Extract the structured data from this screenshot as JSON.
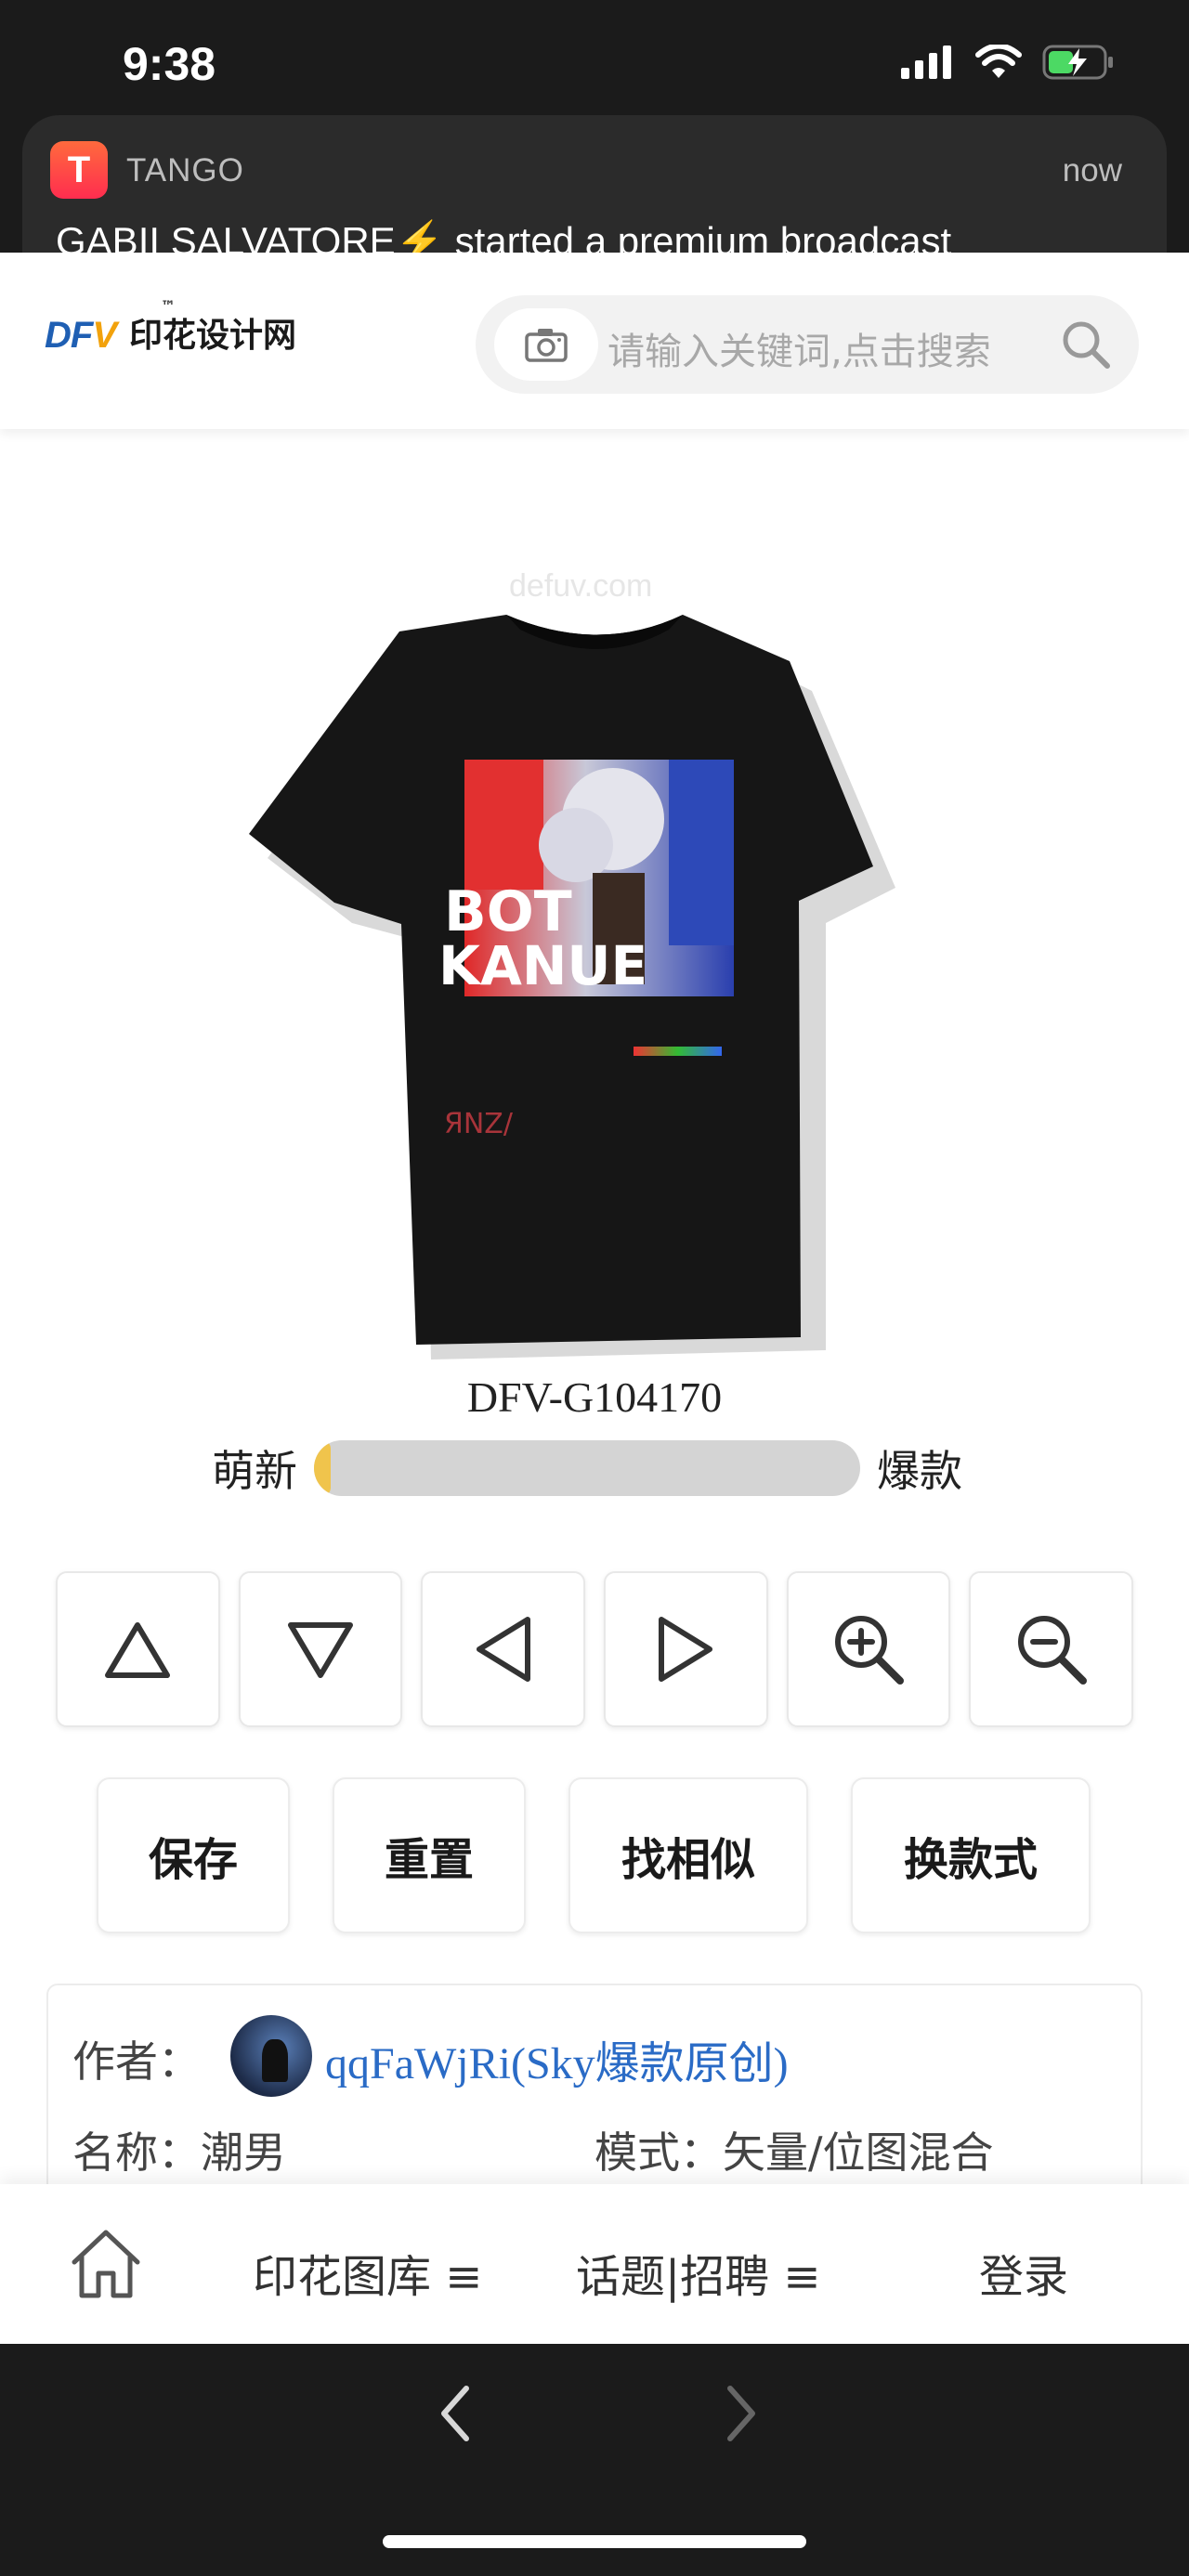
{
  "status_bar": {
    "time": "9:38"
  },
  "notification": {
    "app": "TANGO",
    "time": "now",
    "message": "GABII SALVATORE⚡ started a premium broadcast",
    "icon_letter": "T"
  },
  "header": {
    "logo_brand": "DF",
    "logo_brand_v": "V",
    "logo_tm": "™",
    "logo_text": "印花设计网",
    "search_placeholder": "请输入关键词,点击搜索"
  },
  "product": {
    "watermark": "defuv.com",
    "code": "DFV-G104170",
    "meter": {
      "left_label": "萌新",
      "right_label": "爆款",
      "level": 0.03,
      "fill_color": "#f0c44c"
    }
  },
  "controls": [
    {
      "name": "move-up-button",
      "icon": "triangle-up-icon"
    },
    {
      "name": "move-down-button",
      "icon": "triangle-down-icon"
    },
    {
      "name": "move-left-button",
      "icon": "triangle-left-icon"
    },
    {
      "name": "move-right-button",
      "icon": "triangle-right-icon"
    },
    {
      "name": "zoom-in-button",
      "icon": "zoom-in-icon"
    },
    {
      "name": "zoom-out-button",
      "icon": "zoom-out-icon"
    }
  ],
  "actions": {
    "save": "保存",
    "reset": "重置",
    "find_similar": "找相似",
    "change_style": "换款式"
  },
  "info": {
    "author_label": "作者：",
    "author_name": "qqFaWjRi(Sky爆款原创)",
    "name": "名称：潮男",
    "mode": "模式：矢量/位图混合"
  },
  "bottom_nav": {
    "gallery": "印花图库 ≡",
    "topics": "话题|招聘 ≡",
    "login": "登录"
  },
  "colors": {
    "link": "#2a6bc6",
    "brand_blue": "#1f5fb3",
    "brand_orange": "#f2a20c"
  }
}
